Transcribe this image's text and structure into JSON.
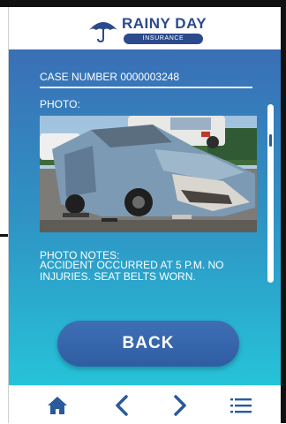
{
  "app": {
    "brand_name": "RAINY DAY",
    "brand_tagline": "INSURANCE",
    "brand_color": "#2c4a8c"
  },
  "case": {
    "number_text": "CASE NUMBER 0000003248"
  },
  "photo": {
    "label": "PHOTO:",
    "subject": "damaged-car-photo"
  },
  "notes": {
    "label": "PHOTO NOTES:",
    "text": "ACCIDENT OCCURRED AT 5 P.M.  NO INJURIES.  SEAT BELTS WORN."
  },
  "actions": {
    "back_label": "BACK"
  },
  "nav": {
    "icons": [
      "home-icon",
      "chevron-left-icon",
      "chevron-right-icon",
      "menu-icon"
    ]
  },
  "colors": {
    "gradient_top": "#3a6fb6",
    "gradient_bottom": "#26c3d8",
    "button": "#2f5da2",
    "nav_icons": "#2a5a9c"
  }
}
